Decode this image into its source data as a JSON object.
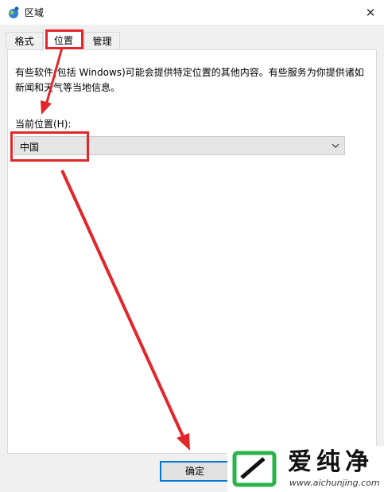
{
  "window": {
    "title": "区域",
    "close_icon": "close-icon",
    "app_icon": "region-globe-icon"
  },
  "tabs": [
    {
      "label": "格式",
      "active": false
    },
    {
      "label": "位置",
      "active": true
    },
    {
      "label": "管理",
      "active": false
    }
  ],
  "location_panel": {
    "description": "有些软件(包括 Windows)可能会提供特定位置的其他内容。有些服务为你提供诸如新闻和天气等当地信息。",
    "current_location_label": "当前位置(H):",
    "current_location_value": "中国"
  },
  "buttons": {
    "ok_label": "确定"
  },
  "annotations": {
    "highlight_color": "#e2262b"
  },
  "watermark": {
    "brand": "爱纯净",
    "url": "www.aichunjing.com",
    "logo_color": "#2ab34a"
  }
}
